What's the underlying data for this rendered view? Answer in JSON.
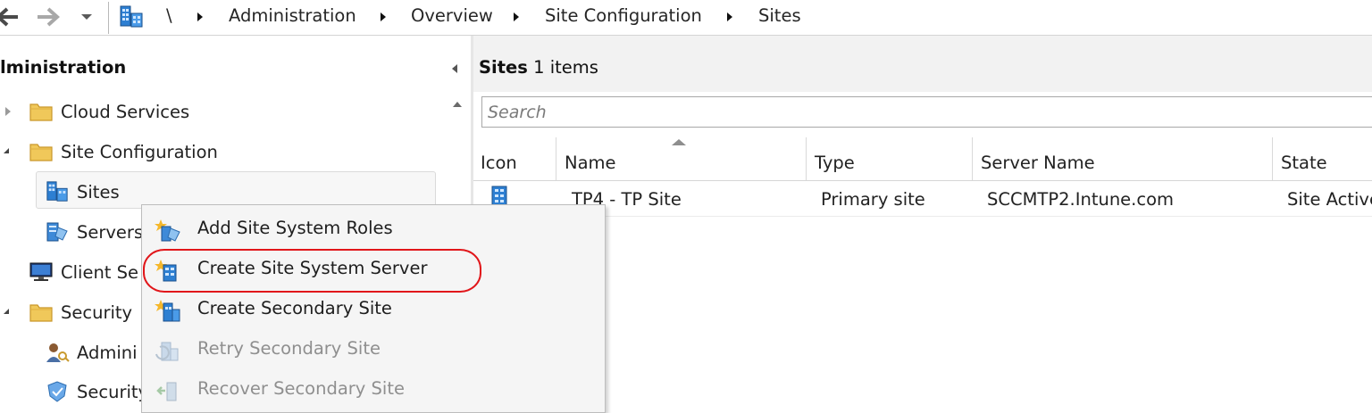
{
  "breadcrumb": {
    "root": "\\",
    "items": [
      "Administration",
      "Overview",
      "Site Configuration",
      "Sites"
    ]
  },
  "nav": {
    "pane_title": "lministration",
    "tree": [
      {
        "label": "Cloud Services",
        "icon": "folder-icon"
      },
      {
        "label": "Site Configuration",
        "icon": "folder-icon"
      },
      {
        "label": "Sites",
        "icon": "sites-icon"
      },
      {
        "label": "Servers",
        "icon": "servers-icon"
      },
      {
        "label": "Client Se",
        "icon": "monitor-icon"
      },
      {
        "label": "Security",
        "icon": "folder-icon"
      },
      {
        "label": "Admini",
        "icon": "administrative-users-icon"
      },
      {
        "label": "Security",
        "icon": "security-scopes-icon"
      }
    ]
  },
  "results": {
    "title_bold": "Sites",
    "title_rest": " 1 items",
    "search_placeholder": "Search",
    "columns": [
      "Icon",
      "Name",
      "Type",
      "Server Name",
      "State"
    ],
    "rows": [
      {
        "icon": "site-icon",
        "name": "TP4 - TP Site",
        "type": "Primary site",
        "server_name": "SCCMTP2.Intune.com",
        "state": "Site Active"
      }
    ]
  },
  "context_menu": {
    "items": [
      {
        "label": "Add Site System Roles",
        "icon": "add-site-system-roles-icon",
        "enabled": true
      },
      {
        "label": "Create Site System Server",
        "icon": "create-site-system-server-icon",
        "enabled": true,
        "highlighted": true
      },
      {
        "label": "Create Secondary Site",
        "icon": "create-secondary-site-icon",
        "enabled": true
      },
      {
        "label": "Retry Secondary Site",
        "icon": "retry-secondary-site-icon",
        "enabled": false
      },
      {
        "label": "Recover Secondary Site",
        "icon": "recover-secondary-site-icon",
        "enabled": false
      }
    ]
  },
  "colors": {
    "highlight_ring": "#e1161a",
    "folder": "#f0c85a",
    "site_blue": "#2d7fd2"
  }
}
